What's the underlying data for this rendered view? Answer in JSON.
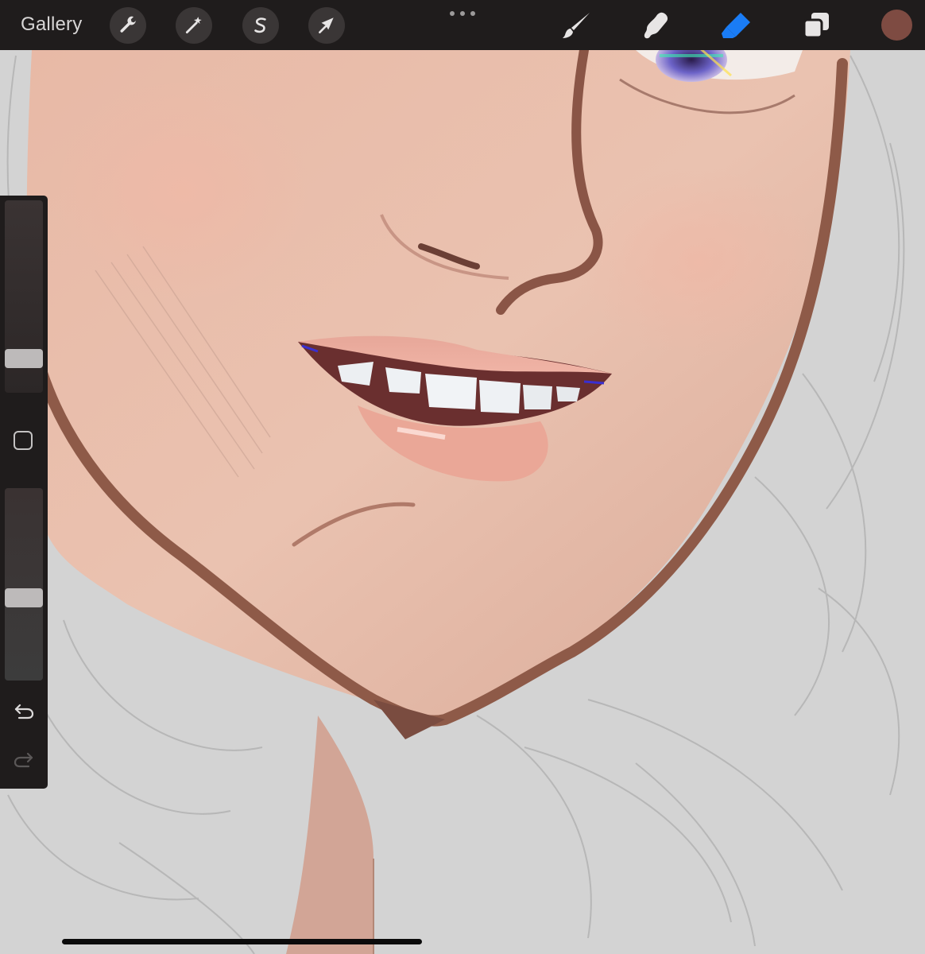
{
  "toolbar": {
    "gallery_label": "Gallery",
    "left_tools": [
      {
        "icon": "wrench-icon",
        "name": "actions"
      },
      {
        "icon": "magic-wand-icon",
        "name": "adjustments"
      },
      {
        "icon": "selection-s-icon",
        "name": "selection"
      },
      {
        "icon": "transform-arrow-icon",
        "name": "transform"
      }
    ],
    "right_tools": [
      {
        "icon": "brush-icon",
        "name": "paint",
        "active": false
      },
      {
        "icon": "smudge-icon",
        "name": "smudge",
        "active": false
      },
      {
        "icon": "eraser-icon",
        "name": "erase",
        "active": true
      },
      {
        "icon": "layers-icon",
        "name": "layers",
        "active": false
      }
    ],
    "current_color": "#7e4b42",
    "active_tool_color": "#1a7cf5"
  },
  "sidebar": {
    "size_slider_level": 0.14,
    "opacity_slider_level": 0.42
  }
}
